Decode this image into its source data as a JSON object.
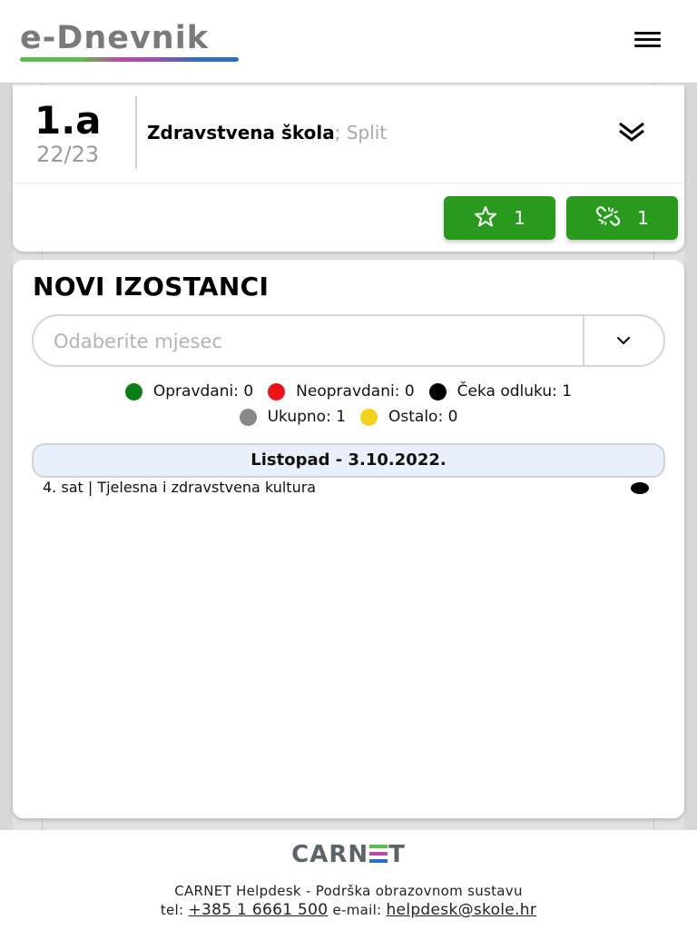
{
  "header": {
    "logo_text": "e-Dnevnik",
    "menu_icon": "hamburger-menu-icon"
  },
  "class_card": {
    "class_name": "1.a",
    "school_year": "22/23",
    "school_name": "Zdravstvena škola",
    "school_city": "; Split",
    "expand_icon": "double-chevron-down-icon",
    "buttons": [
      {
        "icon": "star-icon",
        "count": "1"
      },
      {
        "icon": "broken-link-icon",
        "count": "1"
      }
    ],
    "button_color": "#2a9a1e"
  },
  "absences": {
    "title": "NOVI IZOSTANCI",
    "month_select": {
      "placeholder": "Odaberite mjesec",
      "arrow_icon": "chevron-down-icon"
    },
    "legend": [
      {
        "label": "Opravdani: 0",
        "color": "#0a7d14"
      },
      {
        "label": "Neopravdani: 0",
        "color": "#e8141a"
      },
      {
        "label": "Čeka odluku: 1",
        "color": "#000000"
      },
      {
        "label": "Ukupno: 1",
        "color": "#888888"
      },
      {
        "label": "Ostalo: 0",
        "color": "#f2d21b"
      }
    ],
    "groups": [
      {
        "date_label": "Listopad - 3.10.2022.",
        "items": [
          {
            "text": "4. sat | Tjelesna i zdravstvena kultura",
            "status_color": "#000000"
          }
        ]
      }
    ]
  },
  "footer": {
    "brand": "CARNET",
    "brand_color": "#5d6468",
    "helpdesk_line": "CARNET Helpdesk - Podrška obrazovnom sustavu",
    "tel_label": "tel:",
    "tel_value": "+385 1 6661 500",
    "email_label": "e-mail:",
    "email_value": "helpdesk@skole.hr"
  }
}
